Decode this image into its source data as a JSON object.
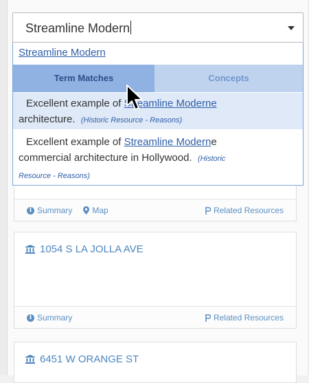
{
  "search": {
    "value": "Streamline Modern"
  },
  "dropdown": {
    "top_match": "Streamline Modern",
    "tabs": [
      {
        "label": "Term Matches"
      },
      {
        "label": "Concepts"
      }
    ],
    "options": [
      {
        "prefix": "Excellent example of ",
        "match": "Streamline Modern",
        "suffix_after_match": "e",
        "line2": "architecture.",
        "context": "(Historic Resource - Reasons)"
      },
      {
        "prefix": "Excellent example of ",
        "match": "Streamline Modern",
        "suffix_after_match": "e",
        "line2": "commercial architecture in Hollywood.",
        "context_part1": "(Historic",
        "context_part2": "Resource - Reasons)"
      }
    ]
  },
  "cards": [
    {
      "footer": {
        "summary": "Summary",
        "map": "Map",
        "related": "Related Resources"
      }
    },
    {
      "title": "1054 S LA JOLLA AVE",
      "footer": {
        "summary": "Summary",
        "related": "Related Resources"
      }
    },
    {
      "title": "6451 W ORANGE ST"
    }
  ],
  "icons": {
    "info": "info-icon",
    "map": "map-pin-icon",
    "related": "related-resources-icon",
    "building": "institution-icon",
    "dropdown": "chevron-down-icon",
    "cursor": "mouse-pointer-icon"
  },
  "colors": {
    "link": "#5b8fc4",
    "active_tab": "#8fb2e3",
    "inactive_tab": "#bfd3ef",
    "highlight": "#dfe9f8",
    "match_text": "#2f5fa8"
  }
}
